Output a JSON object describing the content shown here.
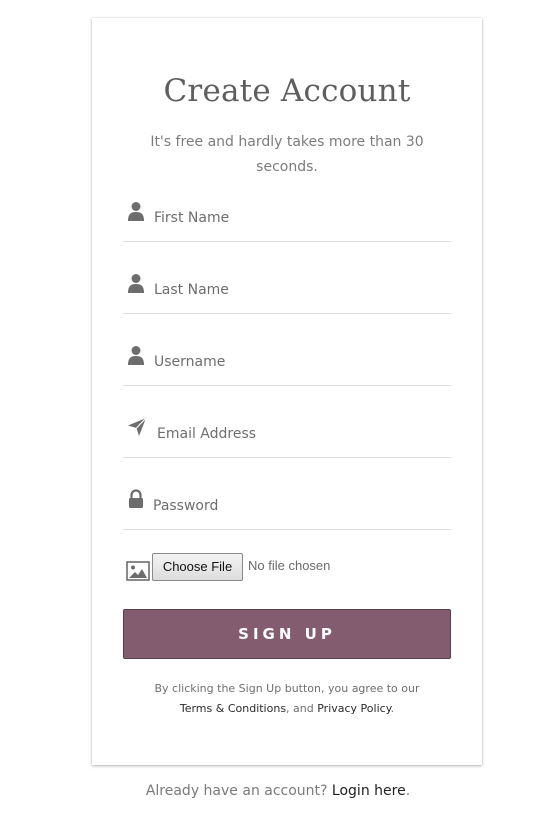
{
  "form": {
    "title": "Create Account",
    "subtitle": "It's free and hardly takes more than 30 seconds.",
    "fields": [
      {
        "icon": "user-icon",
        "placeholder": "First Name"
      },
      {
        "icon": "user-icon",
        "placeholder": "Last Name"
      },
      {
        "icon": "user-icon",
        "placeholder": "Username"
      },
      {
        "icon": "paper-plane-icon",
        "placeholder": "Email Address"
      },
      {
        "icon": "lock-icon",
        "placeholder": "Password"
      }
    ],
    "file": {
      "icon": "image-icon",
      "button_label": "Choose File",
      "status": "No file chosen"
    },
    "submit_label": "SIGN UP",
    "terms": {
      "prefix": "By clicking the Sign Up button, you agree to our",
      "terms_link": "Terms & Conditions",
      "joiner": ", and ",
      "privacy_link": "Privacy Policy",
      "suffix": "."
    }
  },
  "footer": {
    "text": "Already have an account?",
    "link": "Login here",
    "suffix": "."
  },
  "colors": {
    "accent": "#845c70",
    "text_muted": "#7a7a7a"
  }
}
